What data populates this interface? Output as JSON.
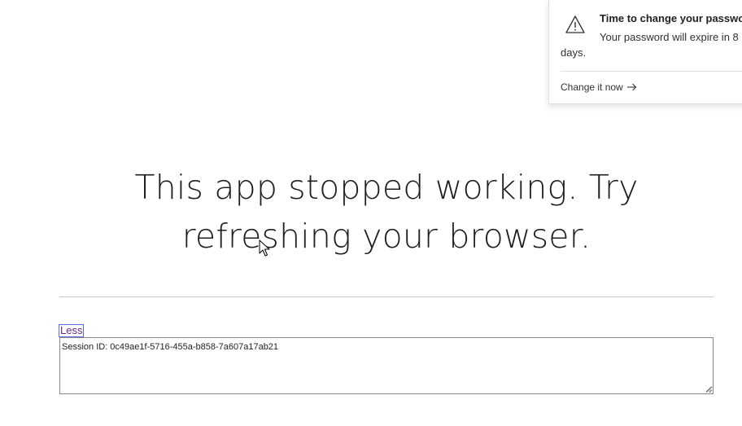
{
  "notification": {
    "icon": "warning-icon",
    "title": "Time to change your password",
    "body": "Your password will expire in 8 days.",
    "action_label": "Change it now",
    "action_icon": "arrow-right-icon"
  },
  "main": {
    "message": "This app stopped working. Try refreshing your browser."
  },
  "details": {
    "toggle_label": "Less",
    "session_text": "Session ID: 0c49ae1f-5716-455a-b858-7a607a17ab21"
  },
  "colors": {
    "link": "#6a2a8a",
    "text": "#201f1e",
    "divider": "#c8c6c4"
  }
}
